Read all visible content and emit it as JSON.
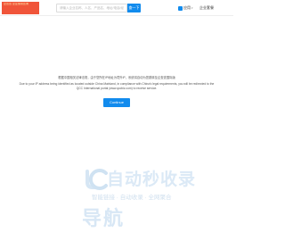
{
  "header": {
    "logo_text": "企查查 企业信用查询",
    "search_placeholder": "请输入企业名称、人名、产品名、地址/电话/经营范围等",
    "search_button": "查一下",
    "app_label": "应用",
    "service_label": "企业套餐"
  },
  "notice": {
    "message_cn": "根据中国相关法律法规，由于您所在IP地址为境外IP，系统将自动为您跳转至企查查国际版",
    "message_en": "Due to your IP address being identified as located outside China Mainland, in compliance with China's legal requirements, you will be redirected to the QCC International portal (www.qccbiz.com) to receive service.",
    "continue_button": "Continue"
  },
  "watermark": {
    "title": "自动秒收录",
    "subtitle": "智能链接 · 自动收录 · 全网聚合",
    "brand": "导航",
    "accent_color": "#dbe9f6"
  },
  "colors": {
    "primary": "#128bed",
    "logo_bg": "#f0553a"
  }
}
